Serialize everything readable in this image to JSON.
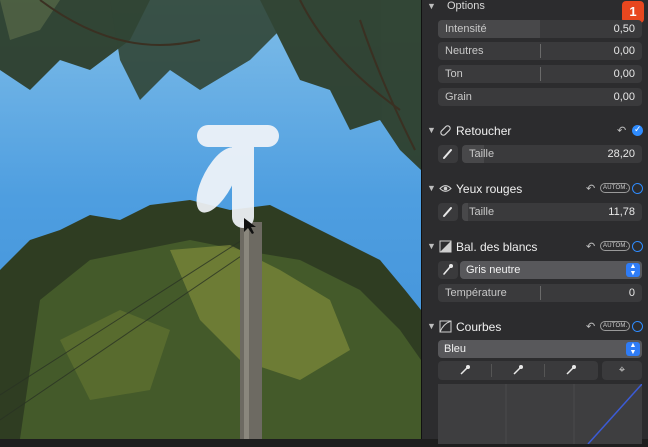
{
  "options": {
    "title": "Options",
    "rows": [
      {
        "label": "Intensité",
        "value": "0,50",
        "fill": 0.5
      },
      {
        "label": "Neutres",
        "value": "0,00",
        "fill": 0.5
      },
      {
        "label": "Ton",
        "value": "0,00",
        "fill": 0.5
      },
      {
        "label": "Grain",
        "value": "0,00",
        "fill": 0.0
      }
    ]
  },
  "badge": "1",
  "retouch": {
    "title": "Retoucher",
    "size_label": "Taille",
    "size_value": "28,20",
    "enabled": true
  },
  "red_eye": {
    "title": "Yeux rouges",
    "auto": "AUTOM.",
    "size_label": "Taille",
    "size_value": "11,78",
    "enabled": false
  },
  "white_balance": {
    "title": "Bal. des blancs",
    "auto": "AUTOM.",
    "mode": "Gris neutre",
    "temp_label": "Température",
    "temp_value": "0",
    "enabled": false
  },
  "curves": {
    "title": "Courbes",
    "auto": "AUTOM.",
    "channel": "Bleu",
    "enabled": false
  },
  "colors": {
    "accent": "#2f8cff",
    "badge": "#e8471f",
    "panel": "#2c2c2e"
  },
  "icons": [
    "chevron-down-icon",
    "bandage-icon",
    "eye-icon",
    "white-balance-icon",
    "curves-icon",
    "undo-icon",
    "brush-icon",
    "eyedropper-icon",
    "crosshair-icon",
    "updown-icon"
  ]
}
